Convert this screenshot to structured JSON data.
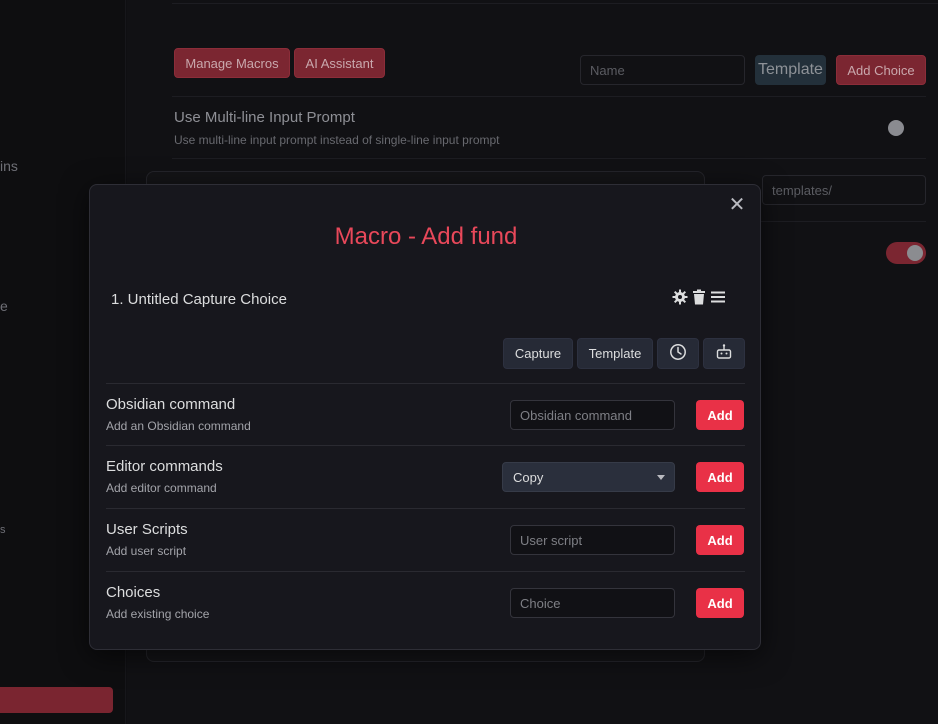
{
  "background": {
    "sidebar_fragments": [
      "ins",
      "e",
      "s"
    ],
    "toolbar": {
      "manage_macros_label": "Manage Macros",
      "ai_assistant_label": "AI Assistant",
      "name_placeholder": "Name",
      "template_label": "Template",
      "add_choice_label": "Add Choice"
    },
    "settings": {
      "multiline_title": "Use Multi-line Input Prompt",
      "multiline_desc": "Use multi-line input prompt instead of single-line input prompt",
      "templates_placeholder": "templates/"
    }
  },
  "modal": {
    "title": "Macro - Add fund",
    "close_icon": "close-icon",
    "command": {
      "name": "1. Untitled Capture Choice",
      "icons": [
        "gear-icon",
        "trash-icon",
        "drag-handle-icon"
      ]
    },
    "segment_buttons": {
      "capture_label": "Capture",
      "template_label": "Template",
      "wait_icon": "clock-icon",
      "ai_icon": "robot-icon"
    },
    "rows": [
      {
        "title": "Obsidian command",
        "desc": "Add an Obsidian command",
        "placeholder": "Obsidian command",
        "add_label": "Add"
      },
      {
        "title": "Editor commands",
        "desc": "Add editor command",
        "select_value": "Copy",
        "add_label": "Add"
      },
      {
        "title": "User Scripts",
        "desc": "Add user script",
        "placeholder": "User script",
        "add_label": "Add"
      },
      {
        "title": "Choices",
        "desc": "Add existing choice",
        "placeholder": "Choice",
        "add_label": "Add"
      }
    ]
  },
  "colors": {
    "accent": "#e93147",
    "title": "#e8485a",
    "modal_bg": "#17171d"
  }
}
